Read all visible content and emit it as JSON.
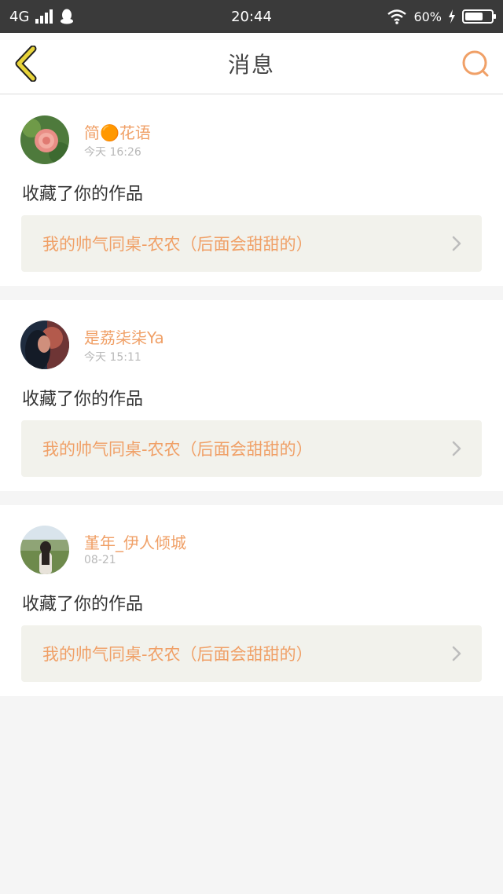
{
  "status_bar": {
    "network": "4G",
    "time": "20:44",
    "battery": "60%"
  },
  "header": {
    "title": "消息"
  },
  "messages": [
    {
      "username": "简🟠花语",
      "time": "今天 16:26",
      "action": "收藏了你的作品",
      "work_title": "我的帅气同桌-农农（后面会甜甜的）"
    },
    {
      "username": "是荔柒柒Ya",
      "time": "今天 15:11",
      "action": "收藏了你的作品",
      "work_title": "我的帅气同桌-农农（后面会甜甜的）"
    },
    {
      "username": "堇年_伊人倾城",
      "time": "08-21",
      "action": "收藏了你的作品",
      "work_title": "我的帅气同桌-农农（后面会甜甜的）"
    }
  ],
  "colors": {
    "accent": "#f0a067",
    "back_icon": "#e8d43a",
    "status_bar_bg": "#3a3a3a"
  }
}
